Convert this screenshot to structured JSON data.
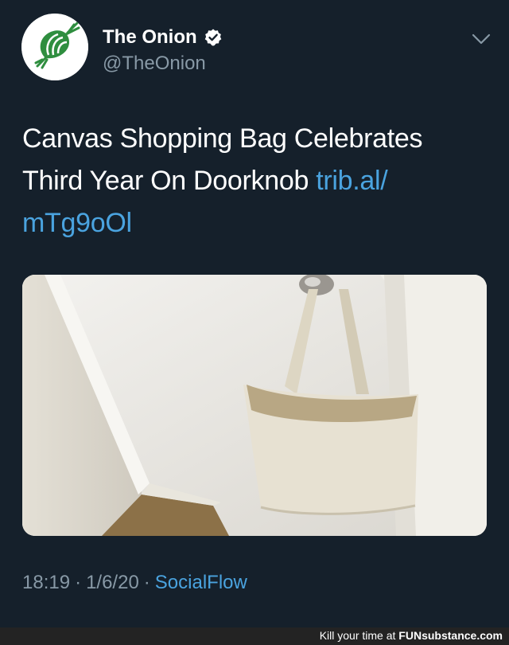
{
  "tweet": {
    "author": {
      "name": "The Onion",
      "handle": "@TheOnion",
      "verified": true,
      "avatar_icon": "onion-logo-icon"
    },
    "text": "Canvas Shopping Bag Celebrates Third Year On Doorknob",
    "link_line1": "trib.al/",
    "link_line2": "mTg9oOl",
    "image_alt_icon": "tote-bag-on-doorknob-photo",
    "time": "18:19",
    "date": "1/6/20",
    "separator": "·",
    "source": "SocialFlow"
  },
  "watermark": {
    "prefix": "Kill your time at ",
    "brand": "FUNsubstance.com"
  },
  "colors": {
    "background": "#15202b",
    "muted": "#8899a6",
    "link": "#4aa3df",
    "verified": "#ffffff",
    "avatar_green": "#2f8e3f"
  }
}
